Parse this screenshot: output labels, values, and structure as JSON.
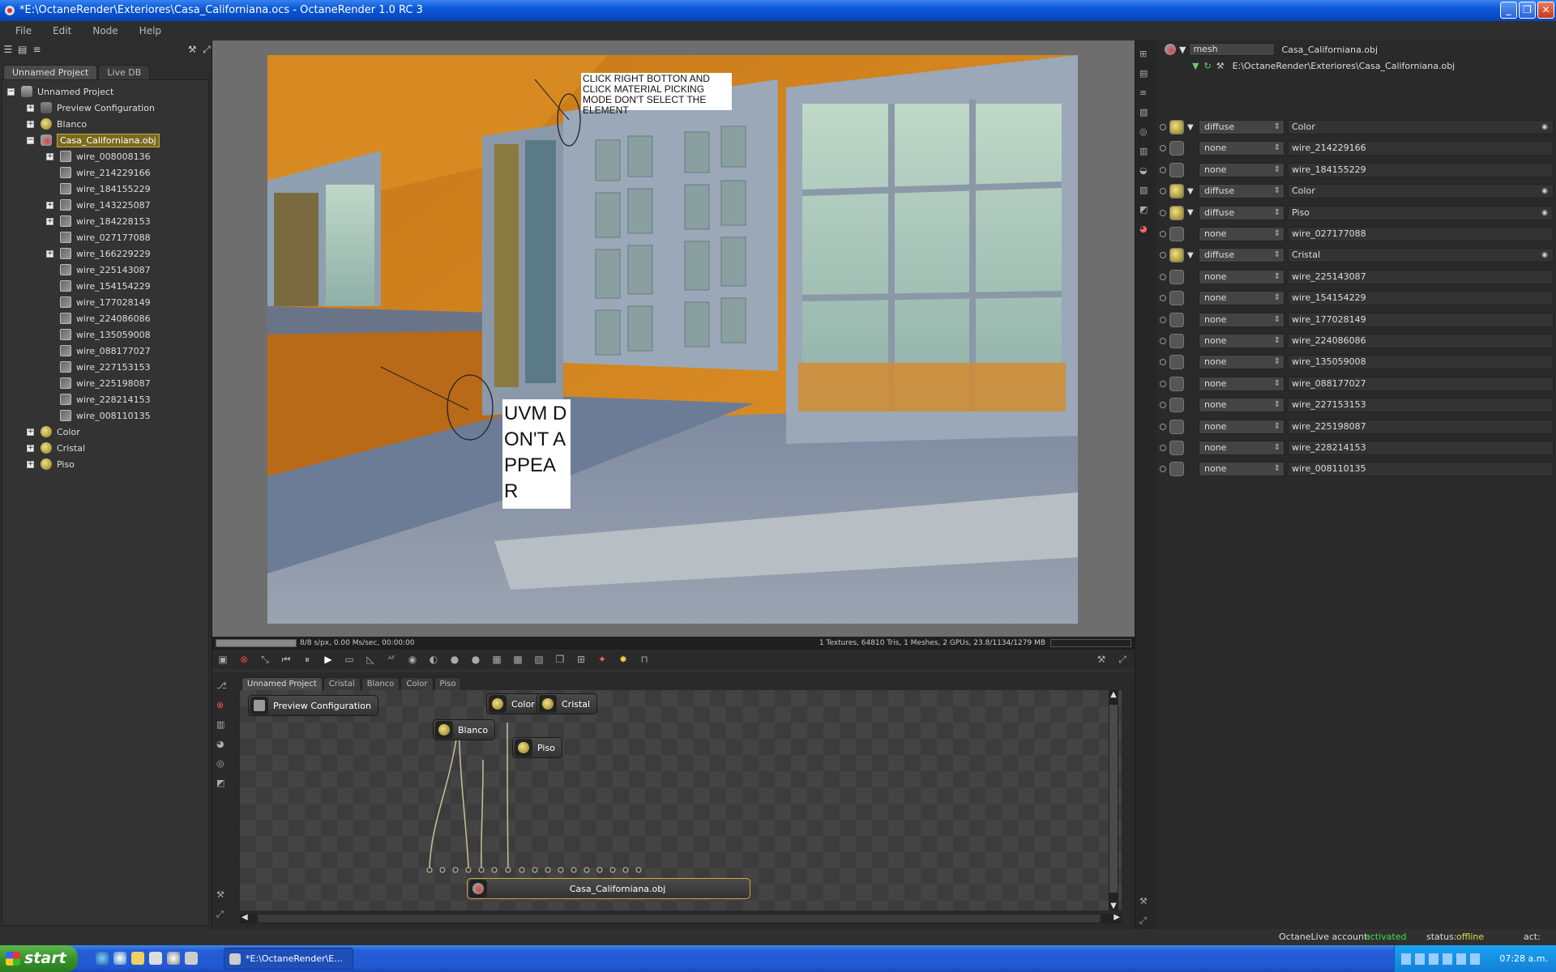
{
  "window": {
    "title": "*E:\\OctaneRender\\Exteriores\\Casa_Californiana.ocs - OctaneRender 1.0 RC 3",
    "minimize": "_",
    "maximize": "❐",
    "close": "✕"
  },
  "menu": [
    "File",
    "Edit",
    "Node",
    "Help"
  ],
  "left": {
    "tabs": [
      "Unnamed Project",
      "Live DB"
    ],
    "tree": [
      {
        "label": "Unnamed Project",
        "level": 0,
        "expander": "−",
        "icon": "proj"
      },
      {
        "label": "Preview Configuration",
        "level": 1,
        "expander": "+",
        "icon": "cfg"
      },
      {
        "label": "Blanco",
        "level": 1,
        "expander": "+",
        "icon": "mat"
      },
      {
        "label": "Casa_Californiana.obj",
        "level": 1,
        "expander": "−",
        "icon": "mesh",
        "selected": true
      },
      {
        "label": "wire_008008136",
        "level": 2,
        "expander": "+",
        "icon": "wire"
      },
      {
        "label": "wire_214229166",
        "level": 2,
        "expander": "",
        "icon": "wire"
      },
      {
        "label": "wire_184155229",
        "level": 2,
        "expander": "",
        "icon": "wire"
      },
      {
        "label": "wire_143225087",
        "level": 2,
        "expander": "+",
        "icon": "wire"
      },
      {
        "label": "wire_184228153",
        "level": 2,
        "expander": "+",
        "icon": "wire"
      },
      {
        "label": "wire_027177088",
        "level": 2,
        "expander": "",
        "icon": "wire"
      },
      {
        "label": "wire_166229229",
        "level": 2,
        "expander": "+",
        "icon": "wire"
      },
      {
        "label": "wire_225143087",
        "level": 2,
        "expander": "",
        "icon": "wire"
      },
      {
        "label": "wire_154154229",
        "level": 2,
        "expander": "",
        "icon": "wire"
      },
      {
        "label": "wire_177028149",
        "level": 2,
        "expander": "",
        "icon": "wire"
      },
      {
        "label": "wire_224086086",
        "level": 2,
        "expander": "",
        "icon": "wire"
      },
      {
        "label": "wire_135059008",
        "level": 2,
        "expander": "",
        "icon": "wire"
      },
      {
        "label": "wire_088177027",
        "level": 2,
        "expander": "",
        "icon": "wire"
      },
      {
        "label": "wire_227153153",
        "level": 2,
        "expander": "",
        "icon": "wire"
      },
      {
        "label": "wire_225198087",
        "level": 2,
        "expander": "",
        "icon": "wire"
      },
      {
        "label": "wire_228214153",
        "level": 2,
        "expander": "",
        "icon": "wire"
      },
      {
        "label": "wire_008110135",
        "level": 2,
        "expander": "",
        "icon": "wire"
      },
      {
        "label": "Color",
        "level": 1,
        "expander": "+",
        "icon": "mat"
      },
      {
        "label": "Cristal",
        "level": 1,
        "expander": "+",
        "icon": "mat"
      },
      {
        "label": "Piso",
        "level": 1,
        "expander": "+",
        "icon": "mat"
      }
    ]
  },
  "annotations": {
    "top_note": "CLICK RIGHT BOTTON AND CLICK MATERIAL PICKING MODE DON'T SELECT THE ELEMENT",
    "uvm_note": "UVM DON'T APPEA R"
  },
  "render_status": {
    "left": "8/8 s/px, 0.00 Ms/sec, 00:00:00",
    "right": "1 Textures, 64810 Tris, 1 Meshes, 2 GPUs, 23.8/1134/1279 MB"
  },
  "node_editor": {
    "tabs": [
      "Unnamed Project",
      "Cristal",
      "Blanco",
      "Color",
      "Piso"
    ],
    "nodes": {
      "preview": "Preview Configuration",
      "blanco": "Blanco",
      "color": "Color",
      "cristal": "Cristal",
      "piso": "Piso",
      "mesh": "Casa_Californiana.obj"
    }
  },
  "right": {
    "type_select": "mesh",
    "name": "Casa_Californiana.obj",
    "path": "E:\\OctaneRender\\Exteriores\\Casa_Californiana.obj",
    "rows": [
      {
        "type": "diffuse",
        "value": "Color",
        "kind": "mat"
      },
      {
        "type": "none",
        "value": "wire_214229166",
        "kind": "none"
      },
      {
        "type": "none",
        "value": "wire_184155229",
        "kind": "none"
      },
      {
        "type": "diffuse",
        "value": "Color",
        "kind": "mat"
      },
      {
        "type": "diffuse",
        "value": "Piso",
        "kind": "mat"
      },
      {
        "type": "none",
        "value": "wire_027177088",
        "kind": "none"
      },
      {
        "type": "diffuse",
        "value": "Cristal",
        "kind": "mat"
      },
      {
        "type": "none",
        "value": "wire_225143087",
        "kind": "none"
      },
      {
        "type": "none",
        "value": "wire_154154229",
        "kind": "none"
      },
      {
        "type": "none",
        "value": "wire_177028149",
        "kind": "none"
      },
      {
        "type": "none",
        "value": "wire_224086086",
        "kind": "none"
      },
      {
        "type": "none",
        "value": "wire_135059008",
        "kind": "none"
      },
      {
        "type": "none",
        "value": "wire_088177027",
        "kind": "none"
      },
      {
        "type": "none",
        "value": "wire_227153153",
        "kind": "none"
      },
      {
        "type": "none",
        "value": "wire_225198087",
        "kind": "none"
      },
      {
        "type": "none",
        "value": "wire_228214153",
        "kind": "none"
      },
      {
        "type": "none",
        "value": "wire_008110135",
        "kind": "none"
      }
    ]
  },
  "status": {
    "account_label": "OctaneLive account:",
    "account_value": "activated",
    "status_label": "status:",
    "status_value": "offline",
    "act_label": "act:",
    "account_color": "#44dd44",
    "status_color": "#dddd44"
  },
  "taskbar": {
    "start": "start",
    "item": "*E:\\OctaneRender\\E...",
    "time": "07:28 a.m."
  }
}
